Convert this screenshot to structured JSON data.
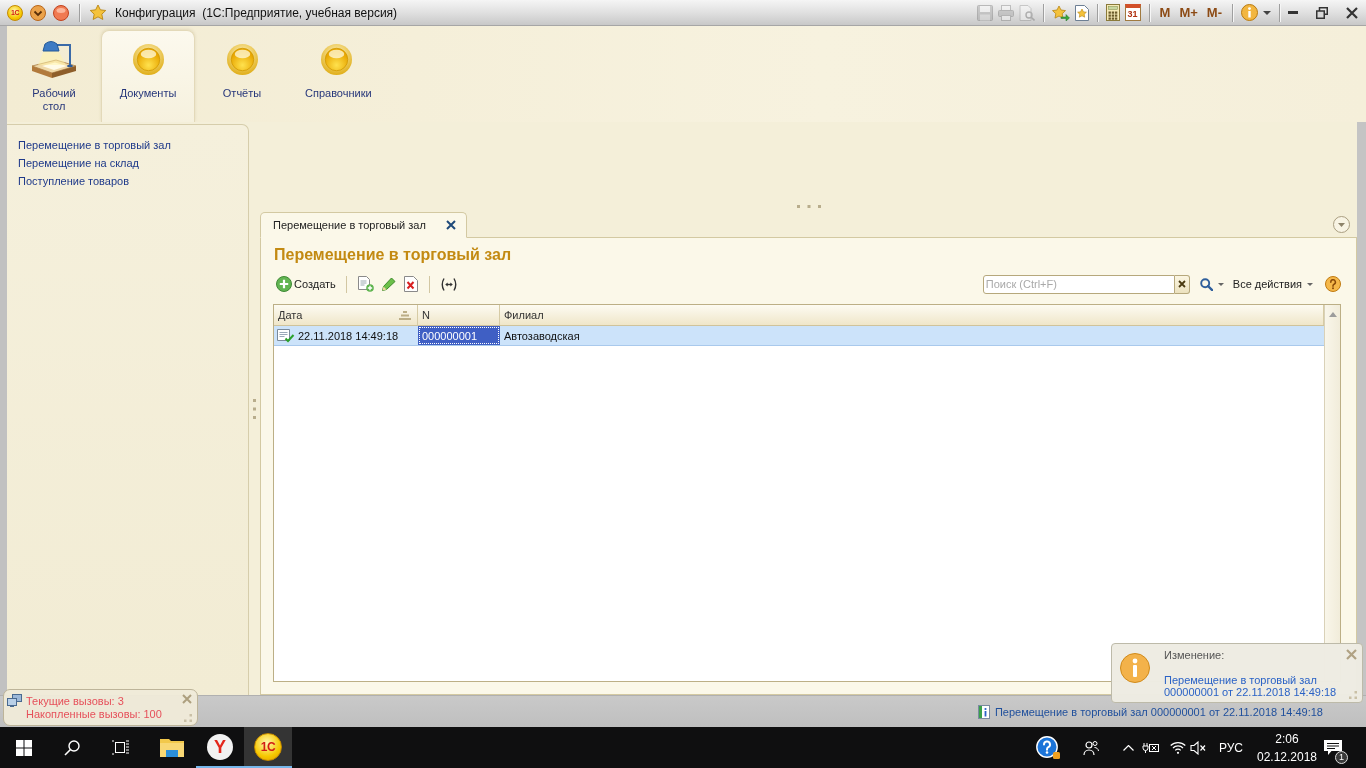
{
  "title_bar": {
    "logo": "1С",
    "title": "Конфигурация  (1С:Предприятие, учебная версия)",
    "document_tools": [
      {
        "kind": "save",
        "disabled": true
      },
      {
        "kind": "print",
        "disabled": true
      },
      {
        "kind": "preview",
        "disabled": true
      }
    ],
    "calendar_day": "31",
    "memory_buttons": [
      "M",
      "M+",
      "M-"
    ]
  },
  "sections": [
    {
      "kind": "desktop",
      "label": "Рабочий стол",
      "selected": false
    },
    {
      "kind": "subsystem",
      "label": "Документы",
      "selected": true
    },
    {
      "kind": "subsystem",
      "label": "Отчёты",
      "selected": false
    },
    {
      "kind": "subsystem",
      "label": "Справочники",
      "selected": false
    }
  ],
  "navigation": [
    "Перемещение в торговый зал",
    "Перемещение на склад",
    "Поступление товаров"
  ],
  "open_tabs": [
    {
      "label": "Перемещение в торговый зал",
      "selected": true
    }
  ],
  "form": {
    "title": "Перемещение в торговый зал",
    "create_button": "Создать",
    "search": {
      "placeholder": "Поиск (Ctrl+F)"
    },
    "all_actions": "Все действия",
    "table": {
      "columns": [
        {
          "label": "Дата",
          "sorted": true
        },
        {
          "label": "N",
          "sorted": false
        },
        {
          "label": "Филиал",
          "sorted": false
        }
      ],
      "rows": [
        {
          "selected": true,
          "posted": true,
          "cells": [
            {
              "text": "22.11.2018 14:49:18",
              "focused": false
            },
            {
              "text": "000000001",
              "focused": true
            },
            {
              "text": "Автозаводская",
              "focused": false
            }
          ]
        }
      ]
    }
  },
  "status_bar": {
    "link": "Перемещение в торговый зал 000000001 от 22.11.2018 14:49:18"
  },
  "call_counter": {
    "lines": [
      "Текущие вызовы: 3",
      "Накопленные вызовы: 100"
    ]
  },
  "notification": {
    "label": "Изменение:",
    "links": [
      "Перемещение в торговый зал",
      "000000001 от 22.11.2018 14:49:18"
    ]
  },
  "taskbar": {
    "apps": [
      {
        "kind": "explorer",
        "running": false,
        "selected": false
      },
      {
        "kind": "yandex",
        "logo": "Y",
        "running": true,
        "selected": false
      },
      {
        "kind": "onec",
        "logo": "1С",
        "running": true,
        "selected": true
      }
    ],
    "language": "РУС",
    "time": "2:06",
    "date": "02.12.2018",
    "notification_count": "1"
  }
}
